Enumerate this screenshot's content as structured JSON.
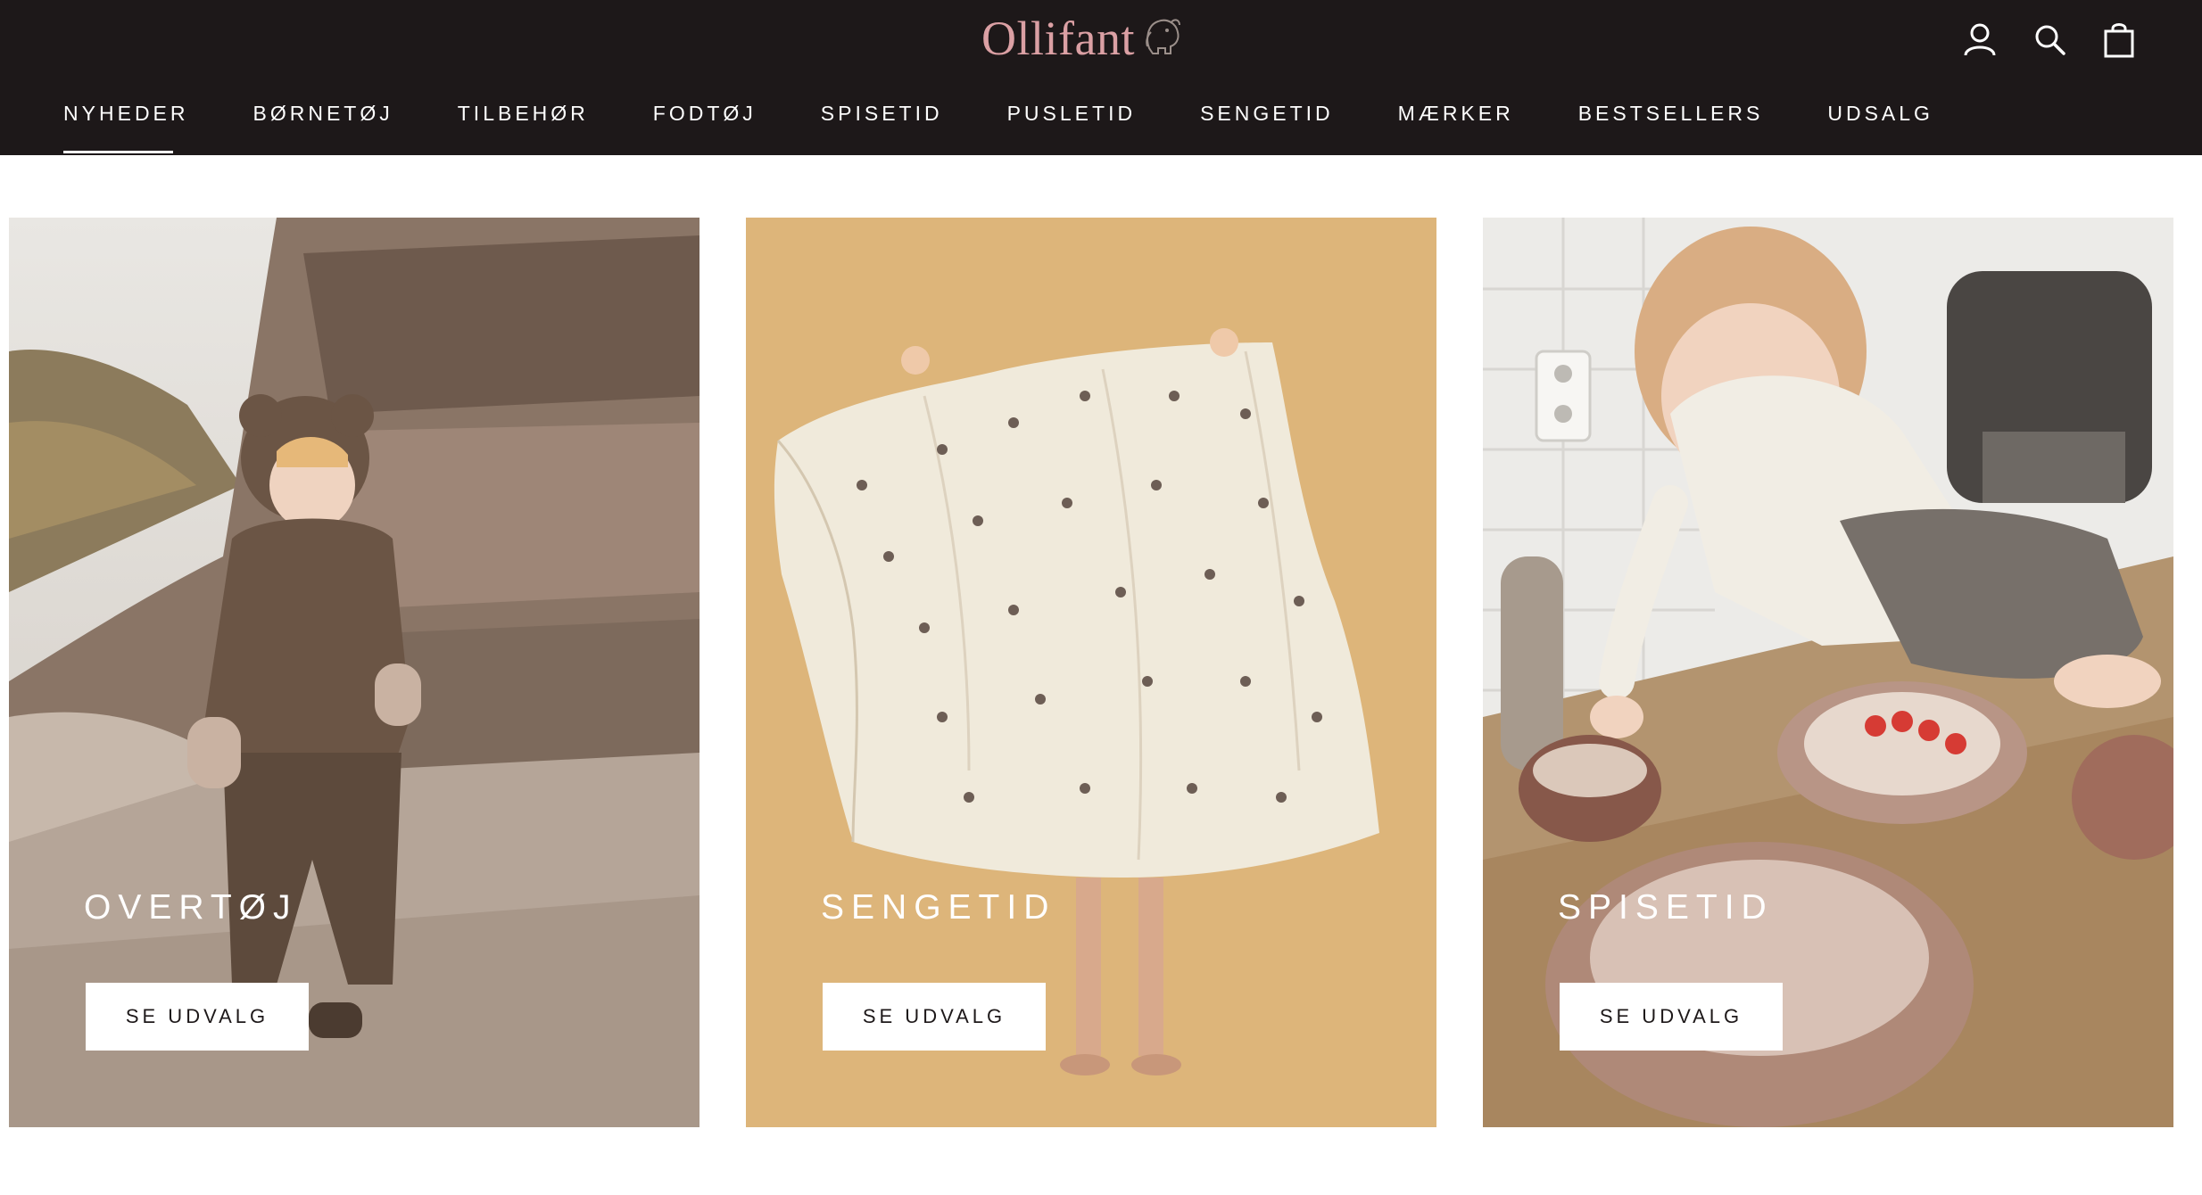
{
  "brand": {
    "name": "Ollifant",
    "logo_color": "#dba0a4"
  },
  "header": {
    "background": "#1d1819",
    "icons": [
      "account-icon",
      "search-icon",
      "cart-icon"
    ]
  },
  "nav": {
    "active": "NYHEDER",
    "items": [
      {
        "label": "NYHEDER"
      },
      {
        "label": "BØRNETØJ"
      },
      {
        "label": "TILBEHØR"
      },
      {
        "label": "FODTØJ"
      },
      {
        "label": "SPISETID"
      },
      {
        "label": "PUSLETID"
      },
      {
        "label": "SENGETID"
      },
      {
        "label": "MÆRKER"
      },
      {
        "label": "BESTSELLERS"
      },
      {
        "label": "UDSALG"
      }
    ]
  },
  "cards": [
    {
      "title": "OVERTØJ",
      "button": "SE UDVALG"
    },
    {
      "title": "SENGETID",
      "button": "SE UDVALG"
    },
    {
      "title": "SPISETID",
      "button": "SE UDVALG"
    }
  ]
}
